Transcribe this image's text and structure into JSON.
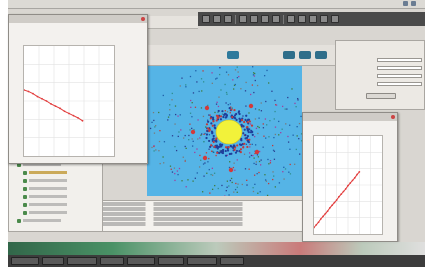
{
  "os": {
    "menu": [
      "",
      "",
      ""
    ],
    "tray_time": ""
  },
  "inspector": {
    "tabs": [
      "",
      ""
    ]
  },
  "colors": {
    "sky": "#55b4e6",
    "core": "#f2f23a",
    "plot_line": "#e23b3b",
    "dark_toolbar": "#4a4a4a"
  },
  "chart_data": [
    {
      "type": "line",
      "title": "",
      "xlabel": "",
      "ylabel": "",
      "x": [
        0,
        1,
        2,
        3,
        4,
        5,
        6,
        7,
        8,
        9,
        10,
        11,
        12,
        13
      ],
      "series": [
        {
          "values": [
            90,
            88,
            85,
            81,
            78,
            75,
            71,
            68,
            65,
            61,
            58,
            55,
            52,
            48
          ]
        }
      ],
      "ylim": [
        0,
        150
      ],
      "xlim": [
        0,
        20
      ],
      "grid": true
    },
    {
      "type": "line",
      "title": "",
      "xlabel": "",
      "ylabel": "",
      "x": [
        0,
        1,
        2,
        3,
        4,
        5,
        6,
        7,
        8,
        9,
        10,
        11,
        12,
        13,
        14,
        15,
        16,
        17,
        18,
        19,
        20
      ],
      "series": [
        {
          "values": [
            10,
            14,
            18,
            23,
            27,
            31,
            35,
            40,
            44,
            48,
            52,
            57,
            61,
            65,
            69,
            74,
            78,
            82,
            86,
            91,
            95
          ]
        }
      ],
      "ylim": [
        0,
        150
      ],
      "xlim": [
        0,
        30
      ],
      "grid": true
    }
  ]
}
